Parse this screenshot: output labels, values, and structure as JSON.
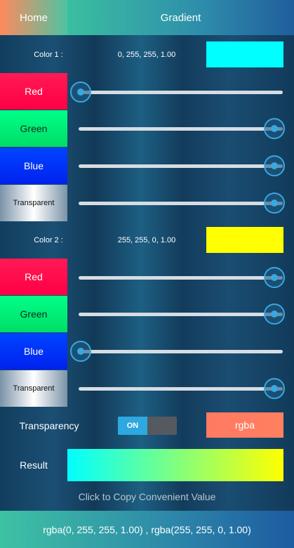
{
  "header": {
    "home_label": "Home",
    "title": "Gradient"
  },
  "color1": {
    "label": "Color 1 :",
    "value": "0, 255, 255, 1.00",
    "swatch": "#00ffff",
    "channels": [
      {
        "label": "Red",
        "value": 0
      },
      {
        "label": "Green",
        "value": 255
      },
      {
        "label": "Blue",
        "value": 255
      },
      {
        "label": "Transparent",
        "value": 1.0
      }
    ]
  },
  "color2": {
    "label": "Color 2 :",
    "value": "255, 255, 0, 1.00",
    "swatch": "#ffff00",
    "channels": [
      {
        "label": "Red",
        "value": 255
      },
      {
        "label": "Green",
        "value": 255
      },
      {
        "label": "Blue",
        "value": 0
      },
      {
        "label": "Transparent",
        "value": 1.0
      }
    ]
  },
  "transparency": {
    "label": "Transparency",
    "toggle_on": "ON",
    "toggle_state": true
  },
  "format_button": "rgba",
  "result": {
    "label": "Result",
    "gradient_from": "#00ffff",
    "gradient_to": "#ffff00"
  },
  "copy_hint": "Click to Copy Convenient Value",
  "footer_value": "rgba(0, 255, 255, 1.00) , rgba(255, 255, 0, 1.00)"
}
